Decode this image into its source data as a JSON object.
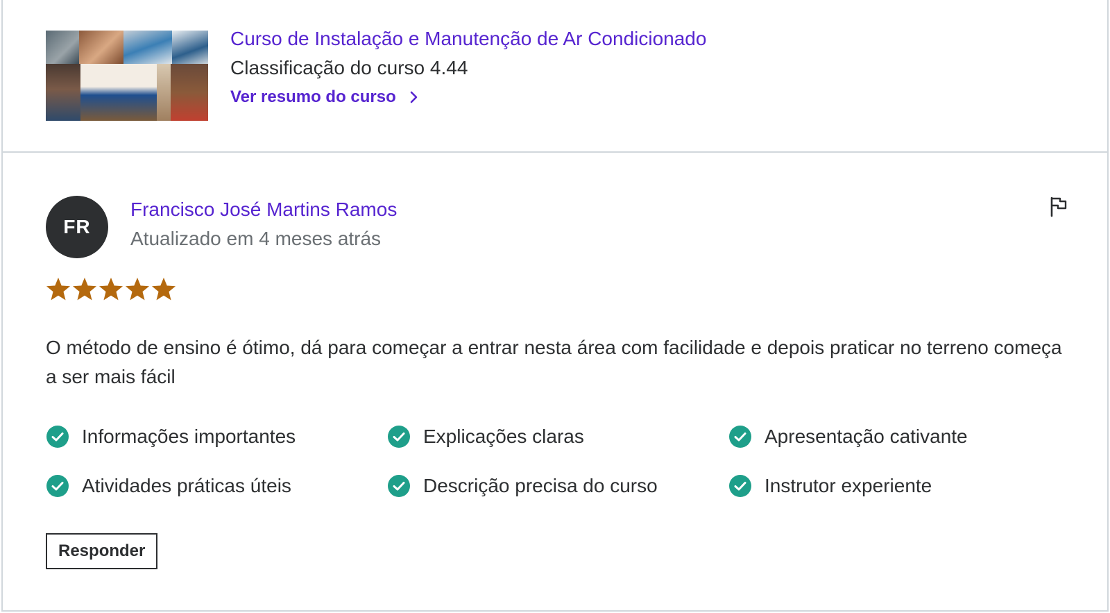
{
  "course": {
    "title": "Curso de Instalação e Manutenção de Ar Condicionado",
    "rating_text": "Classificação do curso 4.44",
    "summary_link": "Ver resumo do curso",
    "thumbnail_icon": "course-thumbnail-collage"
  },
  "review": {
    "avatar_initials": "FR",
    "reviewer_name": "Francisco José Martins Ramos",
    "updated_text": "Atualizado em 4 meses atrás",
    "rating": 5,
    "max_rating": 5,
    "text": "O método de ensino é ótimo, dá para começar a entrar nesta área com facilidade e depois praticar no terreno começa a ser mais fácil",
    "attributes": [
      "Informações importantes",
      "Explicações claras",
      "Apresentação cativante",
      "Atividades práticas úteis",
      "Descrição precisa do curso",
      "Instrutor experiente"
    ],
    "reply_label": "Responder",
    "report_icon": "flag-icon"
  },
  "colors": {
    "brand_purple": "#5624d0",
    "star": "#b4690e",
    "check": "#1e9f8a",
    "text": "#2d2f31",
    "muted": "#6a6f73",
    "border": "#d1d7dc"
  }
}
